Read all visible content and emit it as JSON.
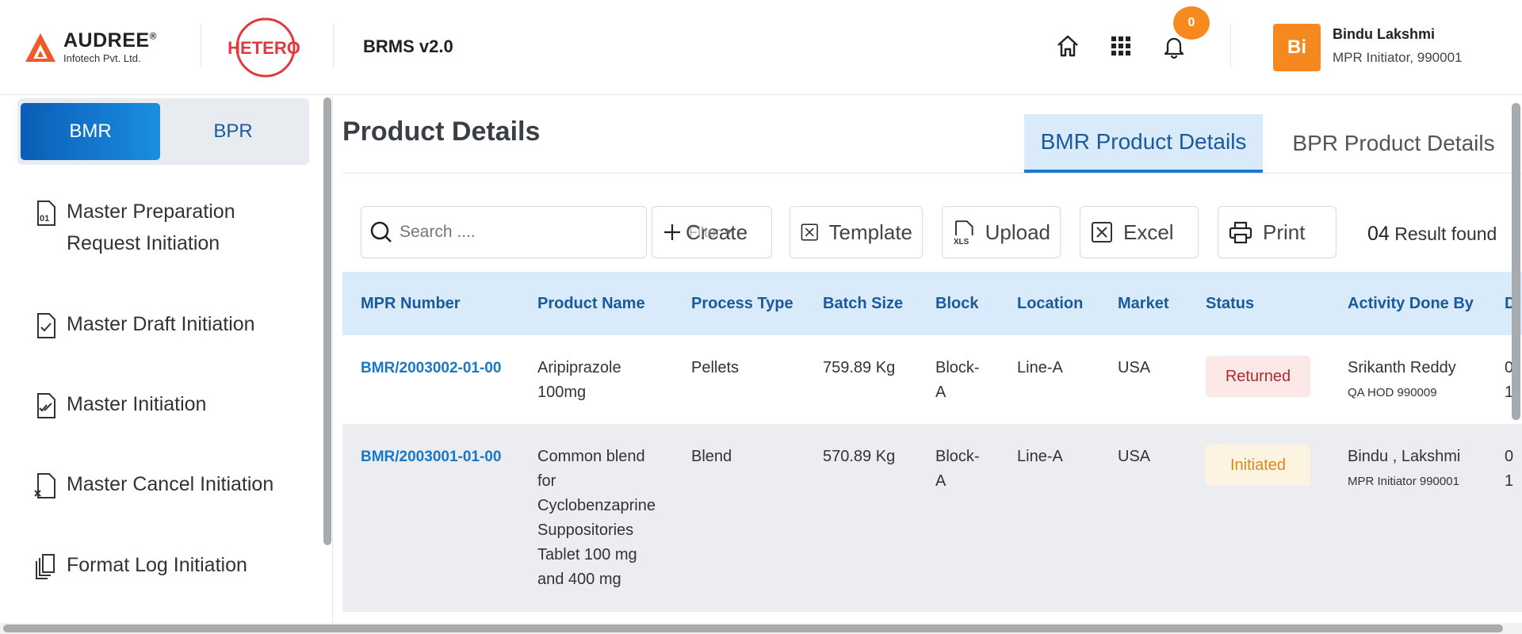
{
  "header": {
    "brand_name": "AUDREE",
    "brand_reg": "®",
    "brand_sub": "Infotech Pvt. Ltd.",
    "partner_logo_text": "HETERO",
    "app_name": "BRMS v2.0",
    "notification_count": "0",
    "user": {
      "initials": "Bi",
      "name": "Bindu Lakshmi",
      "role": "MPR Initiator, 990001"
    },
    "icons": [
      "home-icon",
      "apps-grid-icon",
      "bell-icon"
    ],
    "colors": {
      "accent": "#f5891f",
      "primary": "#1a7bd0"
    }
  },
  "sidebar": {
    "segment": {
      "active": "BMR",
      "inactive": "BPR"
    },
    "items": [
      {
        "label_line1": "Master Preparation",
        "label_line2": "Request Initiation",
        "icon": "document-number-icon"
      },
      {
        "label": "Master Draft Initiation",
        "icon": "document-check-icon"
      },
      {
        "label": "Master Initiation",
        "icon": "document-double-check-icon"
      },
      {
        "label": "Master Cancel Initiation",
        "icon": "document-cancel-icon"
      },
      {
        "label": "Format Log Initiation",
        "icon": "copy-documents-icon"
      }
    ]
  },
  "main": {
    "title": "Product Details",
    "tabs": {
      "active": "BMR Product Details",
      "inactive": "BPR Product Details"
    },
    "search_placeholder": "Search ....",
    "toolbar": {
      "create": "Create",
      "filter": "Filter",
      "template": "Template",
      "upload": "Upload",
      "excel": "Excel",
      "print": "Print"
    },
    "results_count": "04",
    "results_label": "Result found",
    "table": {
      "columns": [
        "MPR Number",
        "Product Name",
        "Process Type",
        "Batch Size",
        "Block",
        "Location",
        "Market",
        "Status",
        "Activity Done By",
        "D"
      ],
      "rows": [
        {
          "mpr": "BMR/2003002-01-00",
          "product": [
            "Aripiprazole",
            "100mg"
          ],
          "process": "Pellets",
          "batch": "759.89 Kg",
          "block": [
            "Block-",
            "A"
          ],
          "location": "Line-A",
          "market": "USA",
          "status": "Returned",
          "by_name": "Srikanth Reddy",
          "by_role": "QA HOD 990009",
          "d": [
            "0",
            "1"
          ]
        },
        {
          "mpr": "BMR/2003001-01-00",
          "product": [
            "Common blend",
            "for",
            "Cyclobenzaprine",
            "Suppositories",
            "Tablet 100 mg",
            "and 400 mg"
          ],
          "process": "Blend",
          "batch": "570.89 Kg",
          "block": [
            "Block-",
            "A"
          ],
          "location": "Line-A",
          "market": "USA",
          "status": "Initiated",
          "by_name": "Bindu , Lakshmi",
          "by_role": "MPR Initiator 990001",
          "d": [
            "0",
            "1"
          ]
        }
      ]
    }
  }
}
